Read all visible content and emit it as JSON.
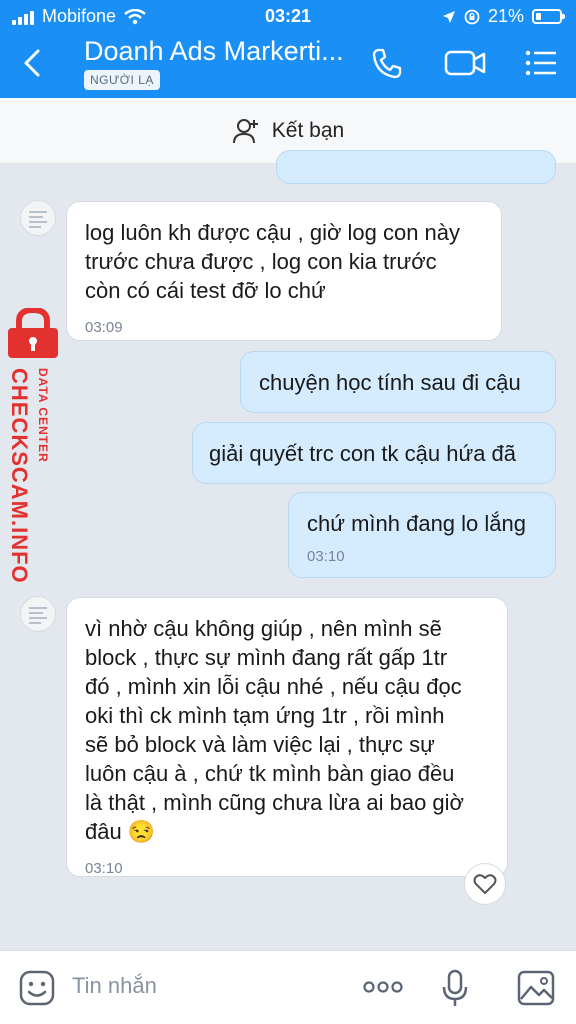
{
  "status": {
    "carrier": "Mobifone",
    "time": "03:21",
    "battery": "21%"
  },
  "header": {
    "title": "Doanh Ads Markerti...",
    "badge": "NGƯỜI LẠ"
  },
  "friend_bar": {
    "label": "Kết bạn"
  },
  "watermark": {
    "main": "CHECKSCAM.INFO",
    "sub": "DATA CENTER"
  },
  "messages": [
    {
      "dir": "in",
      "lines": [
        "log luôn kh được cậu , giờ log con này",
        "trước chưa được , log con kia trước",
        "còn có cái test đỡ lo chứ"
      ],
      "time": "03:09"
    },
    {
      "dir": "out",
      "lines": [
        "chuyện học tính sau đi cậu"
      ]
    },
    {
      "dir": "out",
      "lines": [
        "giải quyết trc con tk cậu hứa đã"
      ]
    },
    {
      "dir": "out",
      "lines": [
        "chứ mình đang lo lắng"
      ],
      "time": "03:10"
    },
    {
      "dir": "in",
      "lines": [
        "vì nhờ cậu không giúp , nên mình sẽ",
        "block , thực sự mình đang rất gấp 1tr",
        "đó , mình xin lỗi cậu nhé , nếu cậu đọc",
        "oki thì ck mình tạm ứng 1tr , rồi mình",
        "sẽ bỏ block và làm việc lại , thực sự",
        "luôn cậu à , chứ tk mình bàn giao đều",
        "là thật , mình cũng chưa lừa ai bao giờ",
        "đâu 😒"
      ],
      "time": "03:10"
    }
  ],
  "input": {
    "placeholder": "Tin nhắn"
  },
  "colors": {
    "header_blue": "#1a90f7",
    "incoming_bubble": "#ffffff",
    "outgoing_bubble": "#d5ecff",
    "watermark_red": "#e3312f"
  }
}
